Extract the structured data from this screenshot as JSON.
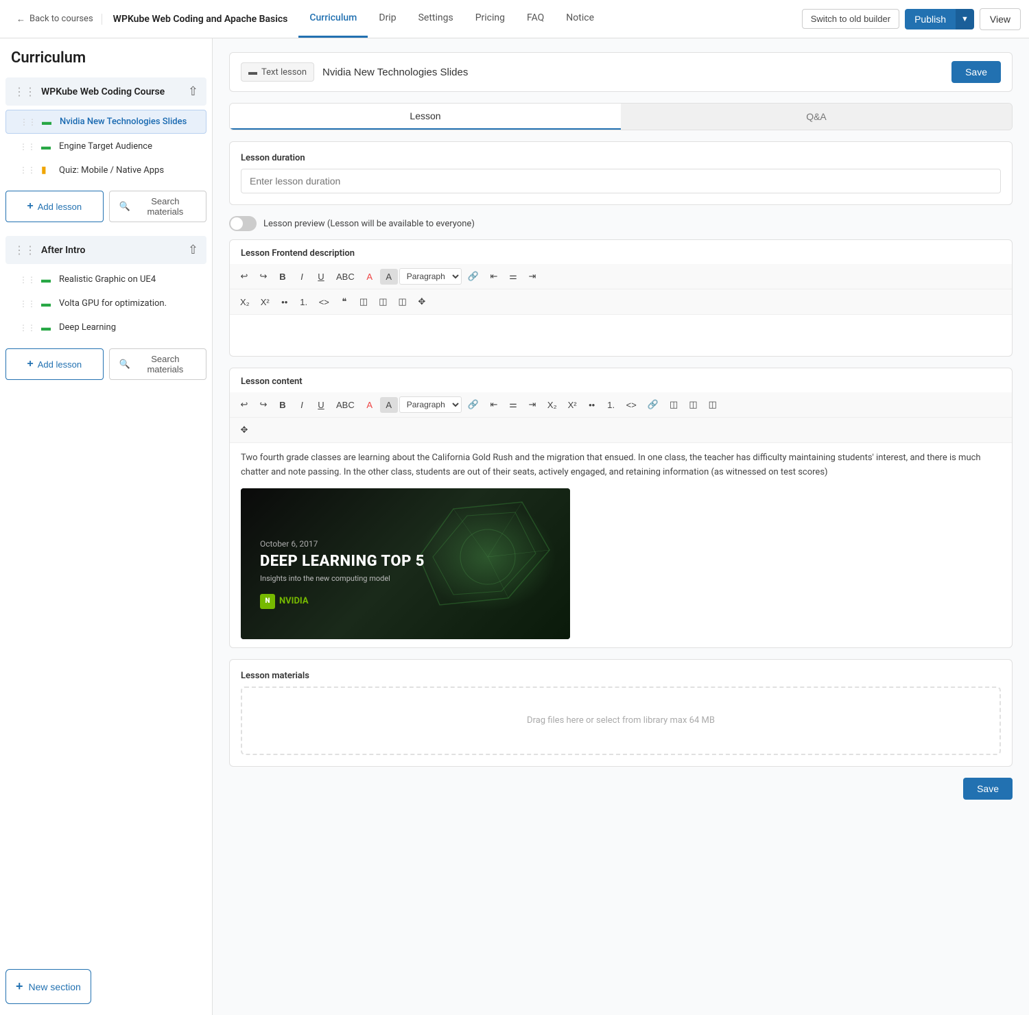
{
  "topnav": {
    "back_label": "Back to courses",
    "course_title": "WPKube Web Coding and Apache Basics",
    "tabs": [
      {
        "id": "curriculum",
        "label": "Curriculum",
        "active": true
      },
      {
        "id": "drip",
        "label": "Drip",
        "active": false
      },
      {
        "id": "settings",
        "label": "Settings",
        "active": false
      },
      {
        "id": "pricing",
        "label": "Pricing",
        "active": false
      },
      {
        "id": "faq",
        "label": "FAQ",
        "active": false
      },
      {
        "id": "notice",
        "label": "Notice",
        "active": false
      }
    ],
    "switch_old_label": "Switch to old builder",
    "publish_label": "Publish",
    "view_label": "View"
  },
  "sidebar": {
    "page_title": "Curriculum",
    "sections": [
      {
        "id": "section1",
        "title": "WPKube Web Coding Course",
        "lessons": [
          {
            "id": "l1",
            "name": "Nvidia New Technologies Slides",
            "type": "text",
            "active": true
          },
          {
            "id": "l2",
            "name": "Engine Target Audience",
            "type": "text",
            "active": false
          },
          {
            "id": "l3",
            "name": "Quiz: Mobile / Native Apps",
            "type": "quiz",
            "active": false
          }
        ],
        "add_lesson_label": "Add lesson",
        "search_materials_label": "Search materials"
      },
      {
        "id": "section2",
        "title": "After Intro",
        "lessons": [
          {
            "id": "l4",
            "name": "Realistic Graphic on UE4",
            "type": "text",
            "active": false
          },
          {
            "id": "l5",
            "name": "Volta GPU for optimization.",
            "type": "text",
            "active": false
          },
          {
            "id": "l6",
            "name": "Deep Learning",
            "type": "text",
            "active": false
          }
        ],
        "add_lesson_label": "Add lesson",
        "search_materials_label": "Search materials"
      }
    ],
    "new_section_label": "New section"
  },
  "lesson_editor": {
    "type_badge": "Text lesson",
    "title_value": "Nvidia New Technologies Slides",
    "save_label": "Save",
    "tabs": [
      {
        "id": "lesson",
        "label": "Lesson",
        "active": true
      },
      {
        "id": "qa",
        "label": "Q&A",
        "active": false
      }
    ],
    "duration_label": "Lesson duration",
    "duration_placeholder": "Enter lesson duration",
    "preview_label": "Lesson preview (Lesson will be available to everyone)",
    "frontend_description_label": "Lesson Frontend description",
    "content_label": "Lesson content",
    "content_text": "Two fourth grade classes are learning about the California Gold Rush and the migration that ensued. In one class, the teacher has difficulty maintaining students' interest, and there is much chatter and note passing. In the other class, students are out of their seats, actively engaged, and retaining information (as witnessed on test scores)",
    "nvidia_date": "October 6, 2017",
    "nvidia_title": "DEEP LEARNING TOP 5",
    "nvidia_subtitle": "Insights into the new computing model",
    "nvidia_logo_text": "NVIDIA",
    "materials_label": "Lesson materials",
    "materials_drop_text": "Drag files here or select from library max 64 MB",
    "save_bottom_label": "Save",
    "toolbar_items": [
      "↩",
      "↪",
      "B",
      "I",
      "U",
      "ABC",
      "A",
      "A",
      "Paragraph",
      "🔗",
      "≡",
      "≡",
      "≡"
    ],
    "toolbar_items2": [
      "↩",
      "↪",
      "B",
      "I",
      "U",
      "ABC",
      "A",
      "A",
      "Paragraph",
      "🔗",
      "≡",
      "≡",
      "≡",
      "X₂",
      "X²",
      "≡",
      "≡",
      "<>",
      "🔗",
      "⊞",
      "⊡",
      "🖼",
      "⤡"
    ]
  }
}
